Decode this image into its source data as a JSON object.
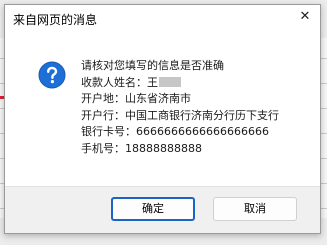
{
  "dialog": {
    "title": "来自网页的消息",
    "icon": "question-icon",
    "close_glyph": "✕",
    "lines": {
      "heading": "请核对您填写的信息是否准确",
      "name": "收款人姓名：王",
      "open_place": "开户地：山东省济南市",
      "open_bank": "开户行：中国工商银行济南分行历下支行",
      "card_no": "银行卡号：6666666666666666666",
      "phone": "手机号：18888888888"
    },
    "ok_label": "确定",
    "cancel_label": "取消"
  },
  "colors": {
    "accent": "#1b63c6",
    "icon_blue": "#1d6fd6"
  }
}
